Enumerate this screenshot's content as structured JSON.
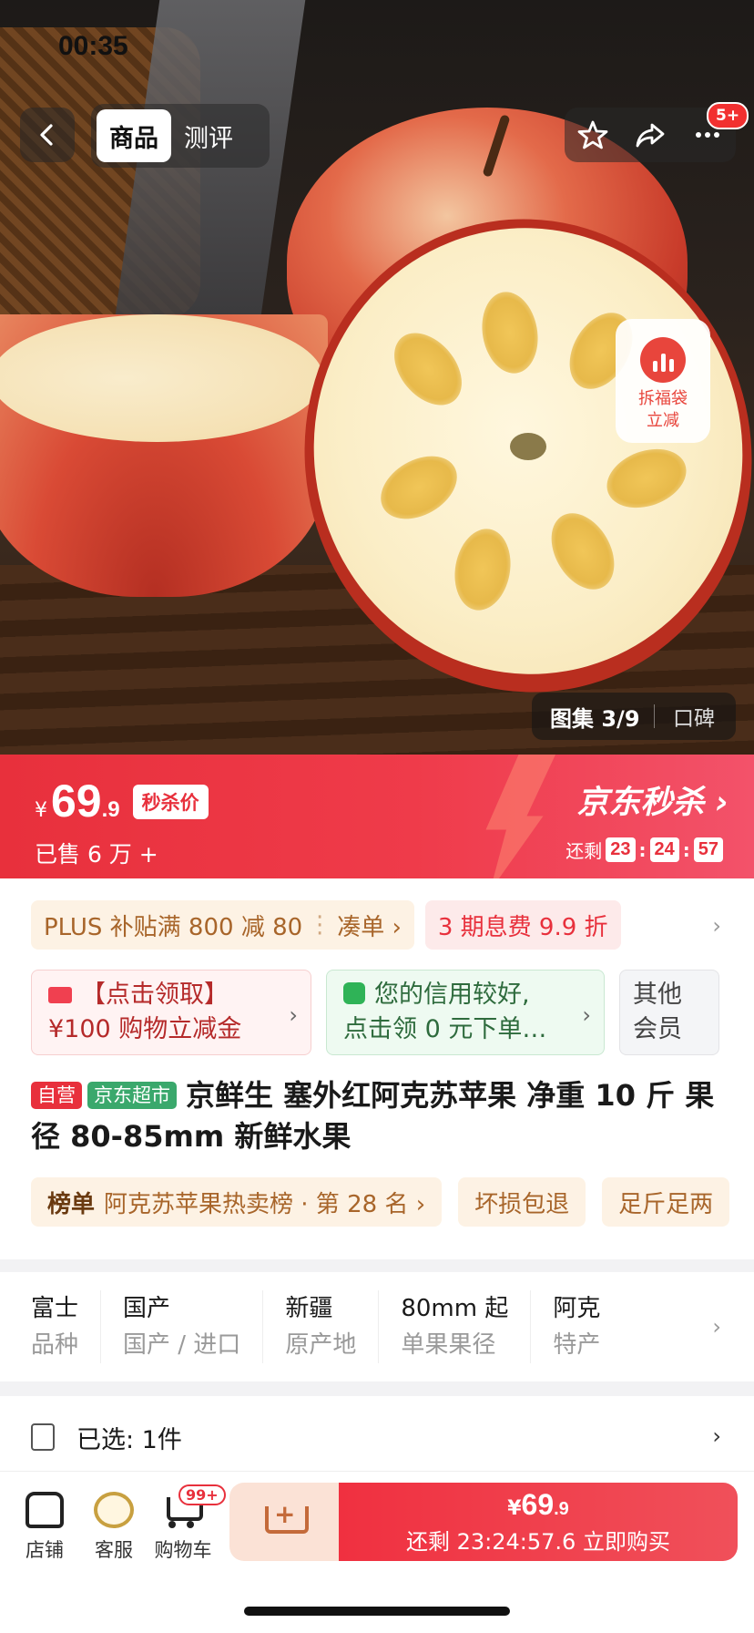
{
  "status_bar": {
    "time": "00:35"
  },
  "top_bar": {
    "tabs": [
      {
        "label": "商品",
        "active": true
      },
      {
        "label": "测评",
        "active": false
      }
    ],
    "more_badge": "5+"
  },
  "floating": {
    "lucky_bag_line1": "拆福袋",
    "lucky_bag_line2": "立减"
  },
  "gallery": {
    "count": "图集 3/9",
    "review": "口碑"
  },
  "price_banner": {
    "currency": "¥",
    "price_int": "69",
    "price_dec": ".9",
    "tag": "秒杀价",
    "sold": "已售 6 万 +",
    "brand": "京东秒杀 ›",
    "countdown_label": "还剩",
    "countdown": {
      "h": "23",
      "m": "24",
      "s": "57"
    }
  },
  "promos": {
    "plus_text": "PLUS 补贴满 800 减 80",
    "plus_action": "凑单 ›",
    "installment": "3 期息费 9.9 折"
  },
  "coupons": [
    {
      "line1": "【点击领取】",
      "line2": "¥100 购物立减金"
    },
    {
      "line1": "您的信用较好,",
      "line2": "点击领 0 元下单…"
    },
    {
      "line1": "其他",
      "line2": "会员"
    }
  ],
  "product": {
    "tag_self": "自营",
    "tag_super": "京东超市",
    "title": "京鲜生  塞外红阿克苏苹果 净重 10 斤 果径 80-85mm 新鲜水果"
  },
  "rank": {
    "label": "榜单",
    "text": "阿克苏苹果热卖榜 · 第 28 名 ›",
    "badge2": "坏损包退",
    "badge3": "足斤足两"
  },
  "specs": [
    {
      "value": "富士",
      "label": "品种"
    },
    {
      "value": "国产",
      "label": "国产 / 进口"
    },
    {
      "value": "新疆",
      "label": "原产地"
    },
    {
      "value": "80mm 起",
      "label": "单果果径"
    },
    {
      "value": "阿克",
      "label": "特产"
    }
  ],
  "selected": {
    "text": "已选:  1件"
  },
  "bottom_bar": {
    "store": "店铺",
    "service": "客服",
    "cart": "购物车",
    "cart_badge": "99+",
    "buy_currency": "¥",
    "buy_int": "69",
    "buy_dec": ".9",
    "buy_label": "还剩 23:24:57.6 立即购买"
  },
  "colors": {
    "brand_red": "#e8303c",
    "plus_gold": "#a8652a",
    "green": "#2fb357"
  }
}
